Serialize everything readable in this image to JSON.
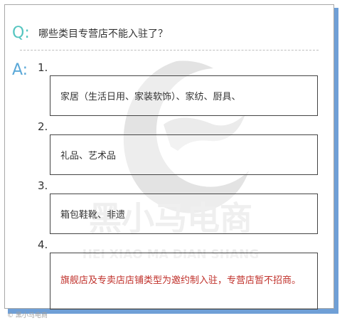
{
  "question": {
    "letter": "Q:",
    "text": "哪些类目专营店不能入驻了？"
  },
  "answer": {
    "letter": "A:",
    "items": [
      {
        "number": "1.",
        "text": "家居（生活日用、家装软饰）、家纺、厨具、"
      },
      {
        "number": "2.",
        "text": "礼品、艺术品"
      },
      {
        "number": "3.",
        "text": "箱包鞋靴、非遗"
      },
      {
        "number": "4.",
        "text": "旗舰店及专卖店店铺类型为邀约制入驻，专营店暂不招商。"
      }
    ]
  },
  "watermark": {
    "brand_cn": "黑小马电商",
    "brand_en": "HEI XIAO MA DIAN SHANG"
  },
  "credit": "© 黑小马电商",
  "colors": {
    "q_accent": "#55c5c0",
    "a_accent": "#5aa8d8",
    "note_red": "#c0312b",
    "card_shadow": "#6f9fd6"
  }
}
